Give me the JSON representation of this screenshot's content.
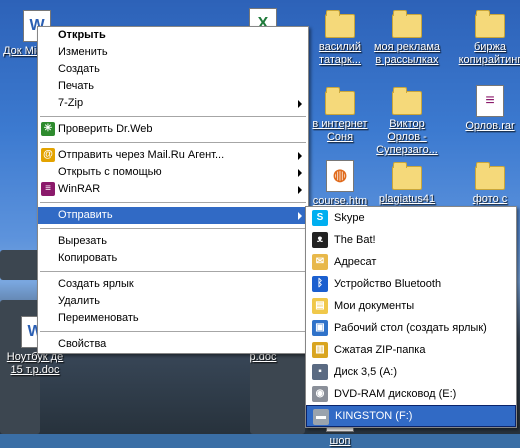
{
  "desktop": {
    "icons": [
      {
        "label": "Док Mic Word",
        "type": "word"
      },
      {
        "label": "",
        "type": "excel"
      },
      {
        "label": "василий татарк...",
        "type": "folder"
      },
      {
        "label": "моя реклама в рассылках",
        "type": "folder"
      },
      {
        "label": "биржа копирайтинг",
        "type": "folder"
      },
      {
        "label": "в интернет Соня",
        "type": "folder"
      },
      {
        "label": "Виктор Орлов - Суперзаго...",
        "type": "folder"
      },
      {
        "label": "Орлов.rar",
        "type": "rar"
      },
      {
        "label": "course.htm",
        "type": "firefox"
      },
      {
        "label": "plagiatus41",
        "type": "folder"
      },
      {
        "label": "фото с",
        "type": "folder"
      },
      {
        "label": "Ноутбук де 15 т.р.doc",
        "type": "word"
      },
      {
        "label": "р.doc",
        "type": "word"
      },
      {
        "label": "шоп",
        "type": "word"
      }
    ]
  },
  "context_menu": {
    "items": [
      {
        "label": "Открыть",
        "bold": true
      },
      {
        "label": "Изменить"
      },
      {
        "label": "Создать"
      },
      {
        "label": "Печать"
      },
      {
        "label": "7-Zip",
        "submenu": true
      },
      {
        "sep": true
      },
      {
        "label": "Проверить Dr.Web",
        "icon": "drweb-icon",
        "icon_color": "#2e8b2e",
        "icon_glyph": "✳"
      },
      {
        "sep": true
      },
      {
        "label": "Отправить через Mail.Ru Агент...",
        "icon": "mailru-agent-icon",
        "icon_color": "#e3a300",
        "icon_glyph": "@",
        "submenu": true
      },
      {
        "label": "Открыть с помощью",
        "submenu": true
      },
      {
        "label": "WinRAR",
        "icon": "winrar-icon",
        "icon_color": "#8b1a6b",
        "icon_glyph": "≡",
        "submenu": true
      },
      {
        "sep": true
      },
      {
        "label": "Отправить",
        "submenu": true,
        "selected": true
      },
      {
        "sep": true
      },
      {
        "label": "Вырезать"
      },
      {
        "label": "Копировать"
      },
      {
        "sep": true
      },
      {
        "label": "Создать ярлык"
      },
      {
        "label": "Удалить"
      },
      {
        "label": "Переименовать"
      },
      {
        "sep": true
      },
      {
        "label": "Свойства"
      }
    ]
  },
  "send_to_menu": {
    "items": [
      {
        "label": "Skype",
        "icon": "skype-icon",
        "icon_color": "#00aff0",
        "icon_glyph": "S"
      },
      {
        "label": "The Bat!",
        "icon": "the-bat-icon",
        "icon_color": "#222222",
        "icon_glyph": "ᴥ"
      },
      {
        "label": "Адресат",
        "icon": "addressee-icon",
        "icon_color": "#e8b84a",
        "icon_glyph": "✉"
      },
      {
        "label": "Устройство Bluetooth",
        "icon": "bluetooth-icon",
        "icon_color": "#1b5fcf",
        "icon_glyph": "ᛒ"
      },
      {
        "label": "Мои документы",
        "icon": "my-documents-icon",
        "icon_color": "#f0c84a",
        "icon_glyph": "▤"
      },
      {
        "label": "Рабочий стол (создать ярлык)",
        "icon": "desktop-shortcut-icon",
        "icon_color": "#2f72c9",
        "icon_glyph": "▣"
      },
      {
        "label": "Сжатая ZIP-папка",
        "icon": "zip-folder-icon",
        "icon_color": "#d9a520",
        "icon_glyph": "▥"
      },
      {
        "label": "Диск 3,5 (A:)",
        "icon": "floppy-icon",
        "icon_color": "#5a6a82",
        "icon_glyph": "▪"
      },
      {
        "label": "DVD-RAM дисковод (E:)",
        "icon": "dvd-drive-icon",
        "icon_color": "#8a8f99",
        "icon_glyph": "◉"
      },
      {
        "label": "KINGSTON (F:)",
        "icon": "usb-drive-icon",
        "icon_color": "#9aa3ad",
        "icon_glyph": "▬",
        "selected": true
      }
    ]
  }
}
